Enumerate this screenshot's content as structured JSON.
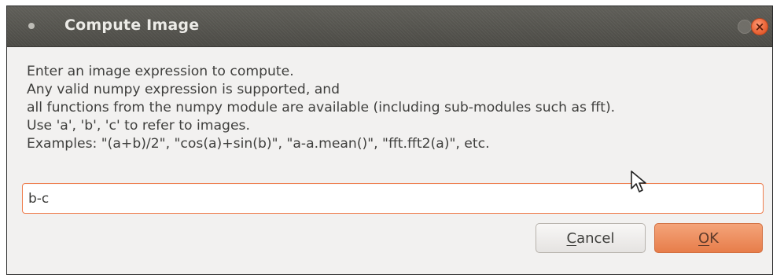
{
  "dialog": {
    "title": "Compute Image",
    "instructions": [
      "Enter an image expression to compute.",
      "Any valid numpy expression is supported, and",
      "all functions from the numpy module are available (including sub-modules such as fft).",
      "Use 'a', 'b', 'c' to refer to images.",
      "Examples:  \"(a+b)/2\", \"cos(a)+sin(b)\", \"a-a.mean()\", \"fft.fft2(a)\", etc."
    ],
    "expression_value": "b-c",
    "buttons": {
      "cancel_mnemonic": "C",
      "cancel_rest": "ancel",
      "ok_mnemonic": "O",
      "ok_rest": "K"
    },
    "icons": {
      "window_menu": "window-menu-icon",
      "unmaximize": "unmaximize-icon",
      "close": "close-icon",
      "mouse_cursor": "mouse-cursor-icon"
    },
    "colors": {
      "titlebar": "#4b4a45",
      "focus_border": "#ef7d4d",
      "ok_button": "#e77d4a",
      "close_button": "#ef6f43"
    }
  }
}
